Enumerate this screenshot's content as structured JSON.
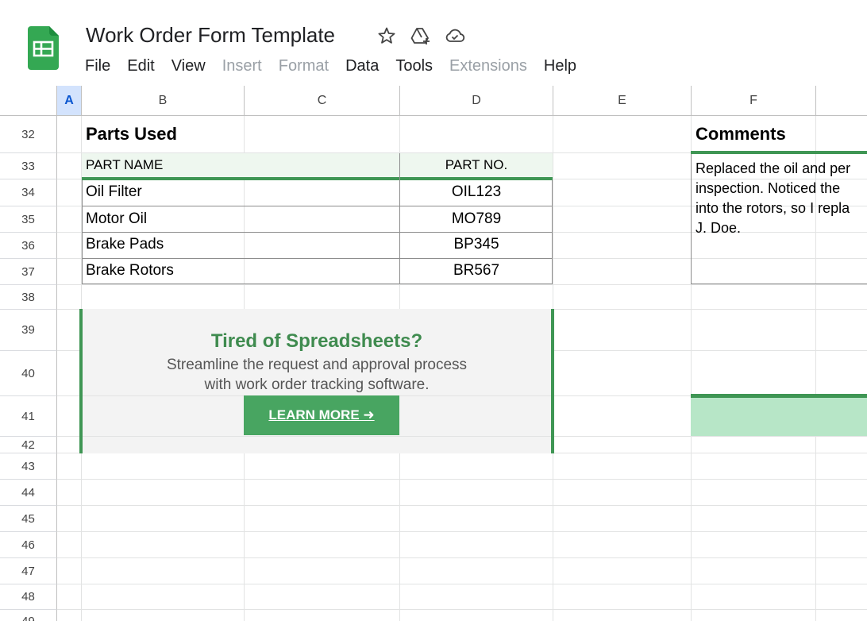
{
  "doc": {
    "title": "Work Order Form Template"
  },
  "menu": [
    {
      "label": "File",
      "disabled": false
    },
    {
      "label": "Edit",
      "disabled": false
    },
    {
      "label": "View",
      "disabled": false
    },
    {
      "label": "Insert",
      "disabled": true
    },
    {
      "label": "Format",
      "disabled": true
    },
    {
      "label": "Data",
      "disabled": false
    },
    {
      "label": "Tools",
      "disabled": false
    },
    {
      "label": "Extensions",
      "disabled": true
    },
    {
      "label": "Help",
      "disabled": false
    }
  ],
  "columns": [
    "A",
    "B",
    "C",
    "D",
    "E",
    "F"
  ],
  "rows": [
    "32",
    "33",
    "34",
    "35",
    "36",
    "37",
    "38",
    "39",
    "40",
    "41",
    "42",
    "43",
    "44",
    "45",
    "46",
    "47",
    "48",
    "49"
  ],
  "parts": {
    "title": "Parts Used",
    "header_name": "PART NAME",
    "header_no": "PART NO.",
    "items": [
      {
        "name": "Oil Filter",
        "no": "OIL123"
      },
      {
        "name": "Motor Oil",
        "no": "MO789"
      },
      {
        "name": "Brake Pads",
        "no": "BP345"
      },
      {
        "name": "Brake Rotors",
        "no": "BR567"
      }
    ]
  },
  "comments": {
    "title": "Comments",
    "text": "Replaced the oil and per\ninspection. Noticed the \ninto the rotors, so I repla\nJ. Doe."
  },
  "promo": {
    "title": "Tired of Spreadsheets?",
    "subtitle": "Streamline the request and approval process\nwith work order tracking software.",
    "button": "LEARN MORE ➜"
  },
  "colors": {
    "accent_green": "#3f9654",
    "button_green": "#48a561",
    "light_green": "#b7e6c7",
    "header_green": "#eef7ef"
  }
}
